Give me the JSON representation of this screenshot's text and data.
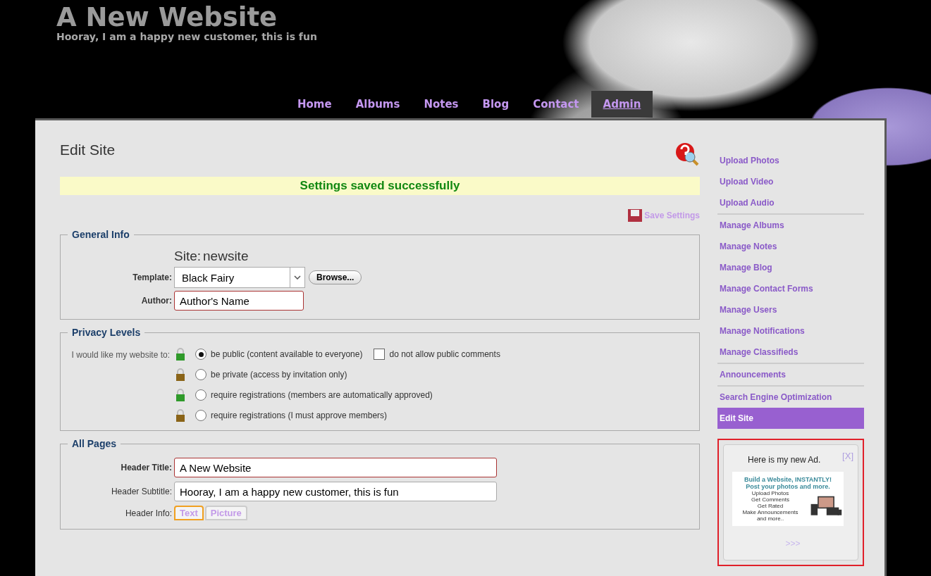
{
  "site": {
    "title": "A New Website",
    "subtitle": "Hooray, I am a happy new customer, this is fun"
  },
  "nav": [
    {
      "label": "Home",
      "selected": false
    },
    {
      "label": "Albums",
      "selected": false
    },
    {
      "label": "Notes",
      "selected": false
    },
    {
      "label": "Blog",
      "selected": false
    },
    {
      "label": "Contact",
      "selected": false
    },
    {
      "label": "Admin",
      "selected": true
    }
  ],
  "page_title": "Edit Site",
  "status_message": "Settings saved successfully",
  "save_button": "Save Settings",
  "general_info": {
    "legend": "General Info",
    "site_label": "Site:",
    "site_value": "newsite",
    "template_label": "Template:",
    "template_value": "Black Fairy",
    "browse_button": "Browse...",
    "author_label": "Author:",
    "author_value": "Author's Name"
  },
  "privacy": {
    "legend": "Privacy Levels",
    "prompt": "I would like my website to:",
    "options": [
      {
        "label": "be public (content available to everyone)",
        "selected": true,
        "color": "#2f9a2a"
      },
      {
        "label": "be private (access by invitation only)",
        "selected": false,
        "color": "#8a6418"
      },
      {
        "label": "require registrations (members are automatically approved)",
        "selected": false,
        "color": "#2f9a2a"
      },
      {
        "label": "require registrations (I must approve members)",
        "selected": false,
        "color": "#8a6418"
      }
    ],
    "comments_checkbox": {
      "label": "do not allow public comments",
      "checked": false
    }
  },
  "all_pages": {
    "legend": "All Pages",
    "header_title_label": "Header Title:",
    "header_title_value": "A New Website",
    "header_subtitle_label": "Header Subtitle:",
    "header_subtitle_value": "Hooray, I am a happy new customer, this is fun",
    "header_info_label": "Header Info:",
    "header_info_tabs": [
      {
        "label": "Text",
        "selected": true
      },
      {
        "label": "Picture",
        "selected": false
      }
    ]
  },
  "sidebar": {
    "groups": [
      [
        {
          "label": "Upload Photos",
          "selected": false
        },
        {
          "label": "Upload Video",
          "selected": false
        },
        {
          "label": "Upload Audio",
          "selected": false
        }
      ],
      [
        {
          "label": "Manage Albums",
          "selected": false
        },
        {
          "label": "Manage Notes",
          "selected": false
        },
        {
          "label": "Manage Blog",
          "selected": false
        },
        {
          "label": "Manage Contact Forms",
          "selected": false
        },
        {
          "label": "Manage Users",
          "selected": false
        },
        {
          "label": "Manage Notifications",
          "selected": false
        },
        {
          "label": "Manage Classifieds",
          "selected": false
        }
      ],
      [
        {
          "label": "Announcements",
          "selected": false
        }
      ],
      [
        {
          "label": "Search Engine Optimization",
          "selected": false
        },
        {
          "label": "Edit Site",
          "selected": true
        }
      ]
    ]
  },
  "ad": {
    "title": "Here is my new Ad.",
    "close": "[X]",
    "banner_headline": "Build a Website, INSTANTLY!",
    "banner_subline": "Post your photos and more.",
    "banner_lines": [
      "Upload Photos",
      "Get Comments",
      "Get Rated",
      "Make Announcements",
      "and more.."
    ],
    "more_link": ">>>"
  }
}
